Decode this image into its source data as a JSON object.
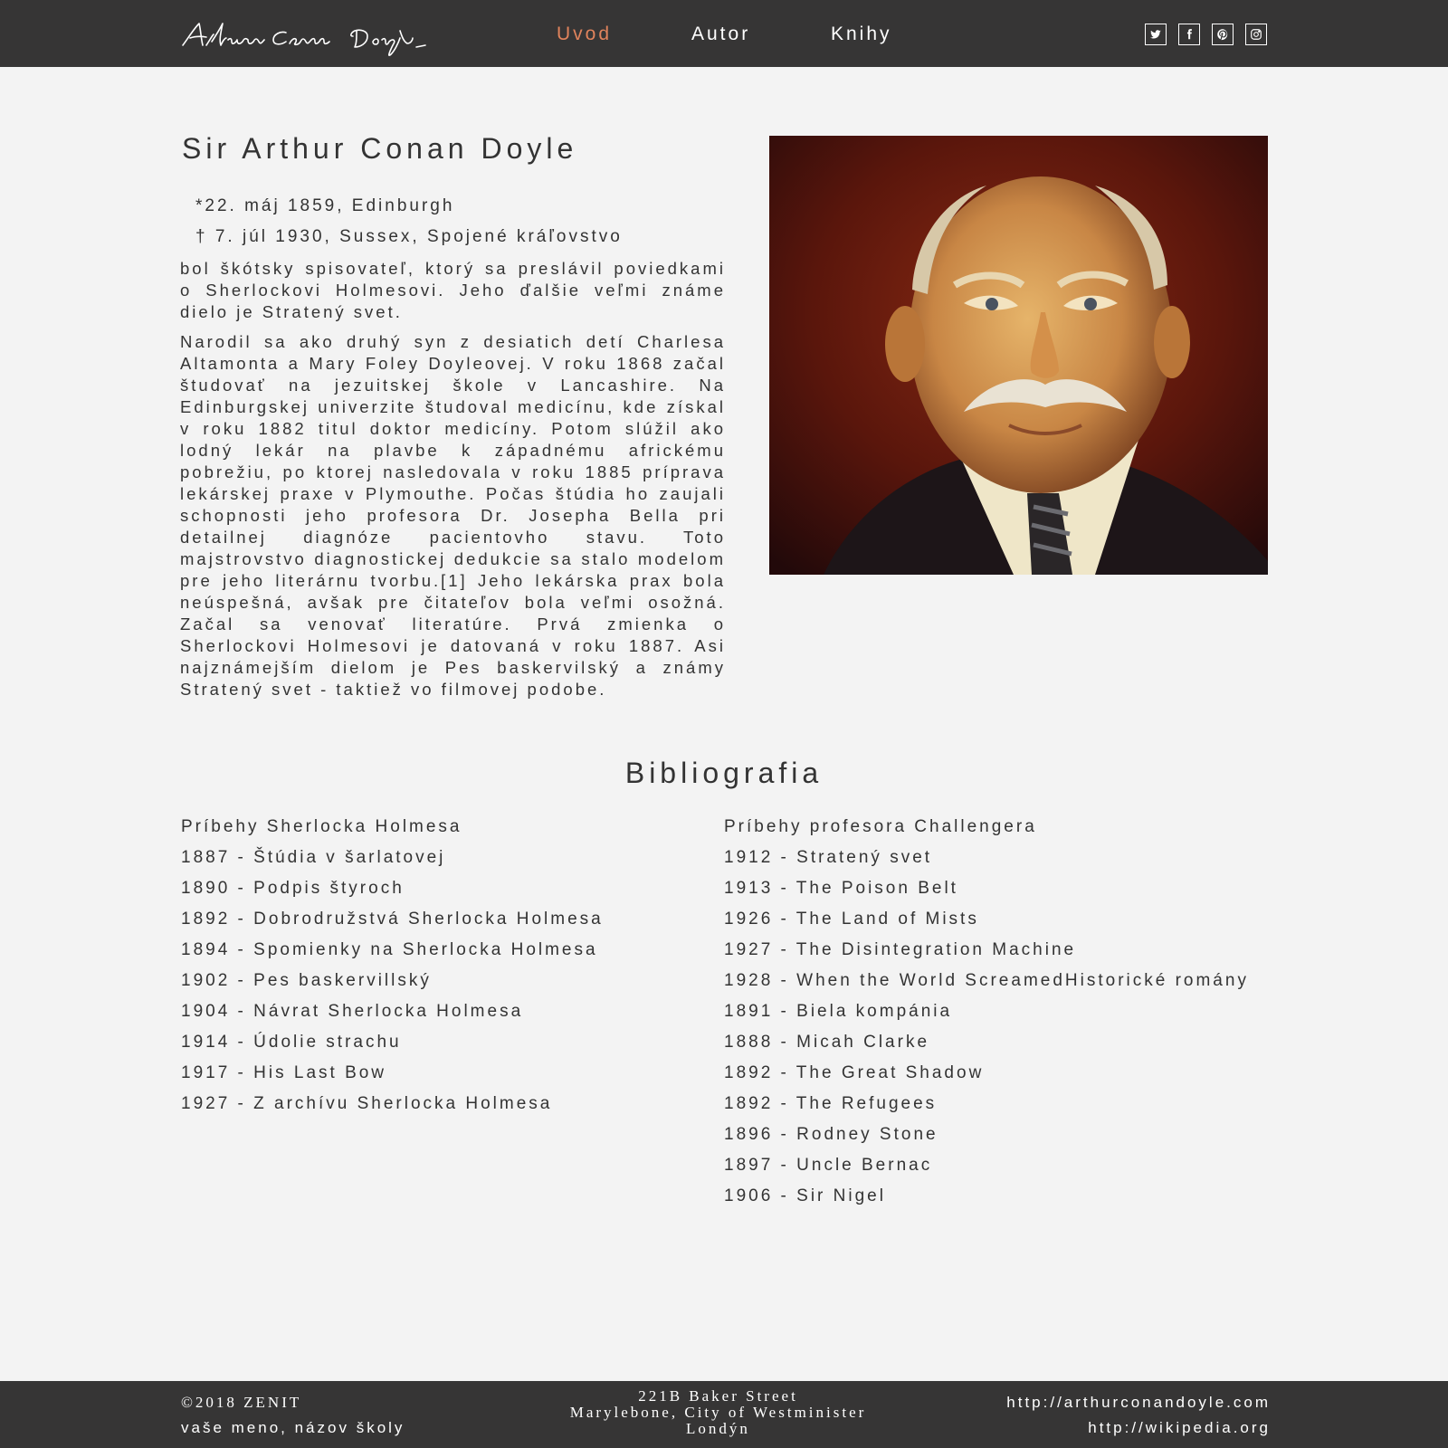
{
  "header": {
    "logo_signature": "Arthur Conan Doyle",
    "nav": [
      {
        "label": "Uvod",
        "active": true
      },
      {
        "label": "Autor",
        "active": false
      },
      {
        "label": "Knihy",
        "active": false
      }
    ],
    "social_icons": [
      "twitter-icon",
      "facebook-icon",
      "pinterest-icon",
      "instagram-icon"
    ],
    "colors": {
      "background": "#363535",
      "active_nav": "#e0835c",
      "text": "#ffffff"
    }
  },
  "main": {
    "title": "Sir Arthur Conan Doyle",
    "born": "*22. máj 1859, Edinburgh",
    "died": "† 7. júl 1930, Sussex, Spojené kráľovstvo",
    "paragraphs": [
      "bol škótsky spisovateľ, ktorý sa preslávil poviedkami o Sherlockovi Holmesovi. Jeho ďalšie veľmi známe dielo je Stratený svet.",
      "Narodil sa ako druhý syn z desiatich detí Charlesa Altamonta a Mary Foley Doyleovej. V roku 1868 začal študovať na jezuitskej škole v Lancashire. Na Edinburgskej univerzite študoval medicínu, kde získal v roku 1882 titul doktor medicíny. Potom slúžil ako lodný lekár na plavbe k západnému africkému pobrežiu, po ktorej nasledovala v roku 1885 prípravа lekárskej praxe v Plymouthe. Počas štúdia ho zaujali schopnosti jeho profesora Dr. Josepha Bella pri detailnej diagnóze pacientovho stavu. Toto majstrovstvo diagnostickej dedukcie sa stalo modelom pre jeho literárnu tvorbu.[1] Jeho lekárska prax bola neúspešná, avšak pre čitateľov bola veľmi osožná. Začal sa venovať literatúre. Prvá zmienka o Sherlockovi Holmesovi je datovaná v roku 1887. Asi najznámejším dielom je Pes baskervilský a známy Stratený svet - taktiež vo filmovej podobe."
    ],
    "portrait_alt": "portrait"
  },
  "bibliography": {
    "title": "Bibliografia",
    "left": [
      "Príbehy Sherlocka Holmesa",
      "1887 - Štúdia v šarlatovej",
      "1890 - Podpis štyroch",
      "1892 - Dobrodružstvá Sherlocka Holmesa",
      "1894 - Spomienky na Sherlocka Holmesa",
      "1902 - Pes baskervillský",
      "1904 - Návrat Sherlocka Holmesa",
      "1914 - Údolie strachu",
      "1917 - His Last Bow",
      "1927 - Z archívu Sherlocka Holmesa"
    ],
    "right": [
      "Príbehy profesora Challengera",
      "1912 - Stratený svet",
      "1913 - The Poison Belt",
      "1926 - The Land of Mists",
      "1927 - The Disintegration Machine",
      "1928 - When the World ScreamedHistorické romány",
      "1891 - Biela kompánia",
      "1888 - Micah Clarke",
      "1892 - The Great Shadow",
      "1892 - The Refugees",
      "1896 - Rodney Stone",
      "1897 - Uncle Bernac",
      "1906 - Sir Nigel"
    ]
  },
  "footer": {
    "copyright": "©2018 ZENIT",
    "school": "vaše meno, názov školy",
    "address": [
      "221B Baker Street",
      "Marylebone, City of Westminister",
      "Londýn"
    ],
    "links": [
      "http://arthurconandoyle.com",
      "http://wikipedia.org"
    ]
  }
}
